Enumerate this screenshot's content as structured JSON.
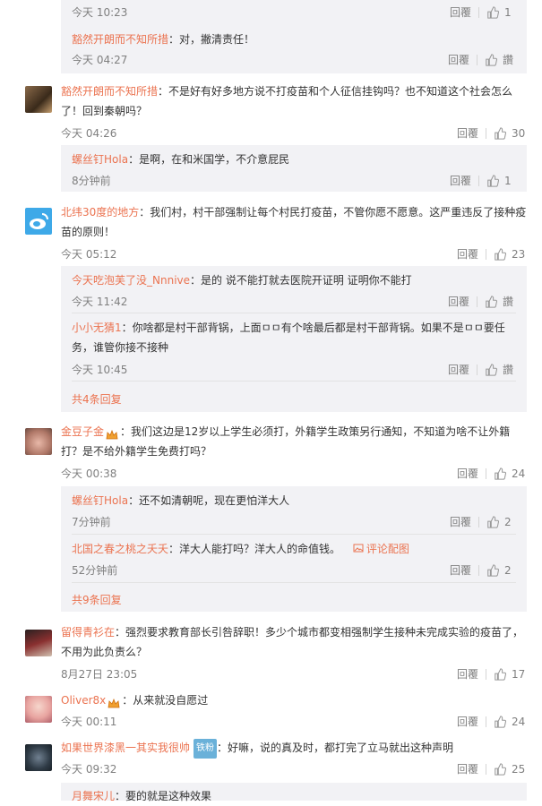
{
  "ui": {
    "reply_label": "回覆",
    "like_icon_text": "讚"
  },
  "c0": {
    "r0": {
      "time": "今天 10:23",
      "likes": "1"
    },
    "r1": {
      "author": "豁然开朗而不知所措",
      "text": "：对，撇清责任！",
      "time": "今天 04:27"
    }
  },
  "c1": {
    "author": "豁然开朗而不知所措",
    "text": "：不是好有好多地方说不打疫苗和个人征信挂钩吗？也不知道这个社会怎么了！回到秦朝吗？",
    "time": "今天 04:26",
    "likes": "30",
    "r0": {
      "author": "螺丝钉Hola",
      "text": "：是啊，在和米国学，不介意屁民",
      "time": "8分钟前",
      "likes": "1"
    }
  },
  "c2": {
    "author": "北纬30度的地方",
    "text": "：我们村，村干部强制让每个村民打疫苗，不管你愿不愿意。这严重违反了接种疫苗的原则！",
    "time": "今天 05:12",
    "likes": "23",
    "r0": {
      "author": "今天吃泡芙了没_Nnnive",
      "text": "：是的   说不能打就去医院开证明 证明你不能打",
      "time": "今天 11:42"
    },
    "r1": {
      "author": "小小无猜1",
      "text": "：你啥都是村干部背锅，上面ㅁㅁ有个啥最后都是村干部背锅。如果不是ㅁㅁ要任务，谁管你接不接种",
      "time": "今天 10:45"
    },
    "more": "共4条回复"
  },
  "c3": {
    "author": "金豆子金",
    "text": "：我们这边是12岁以上学生必须打，外籍学生政策另行通知，不知道为啥不让外籍打？是不给外籍学生免费打吗？",
    "time": "今天 00:38",
    "likes": "24",
    "r0": {
      "author": "螺丝钉Hola",
      "text": "：还不如清朝呢，现在更怕洋大人",
      "time": "7分钟前",
      "likes": "2"
    },
    "r1": {
      "author": "北国之春之桃之夭夭",
      "text": "：洋大人能打吗？洋大人的命值钱。",
      "pic": "评论配图",
      "time": "52分钟前",
      "likes": "2"
    },
    "more": "共9条回复"
  },
  "c4": {
    "author": "留得青衫在",
    "text": "：强烈要求教育部长引咎辞职！多少个城市都变相强制学生接种未完成实验的疫苗了，不用为此负责么？",
    "time": "8月27日 23:05",
    "likes": "17"
  },
  "c5": {
    "author": "Oliver8x",
    "text": "：从来就没自愿过",
    "time": "今天 00:11",
    "likes": "24"
  },
  "c6": {
    "author": "如果世界漆黑一其实我很帅",
    "badge": "铁粉",
    "text": "：好嘛，说的真及时，都打完了立马就出这种声明",
    "time": "今天 09:32",
    "likes": "25",
    "r0": {
      "author": "月舞宋儿",
      "text": "：要的就是这种效果"
    }
  },
  "colors": {
    "accent": "#eb7350",
    "meta": "#808080",
    "sub_bg": "#f2f2f5"
  }
}
